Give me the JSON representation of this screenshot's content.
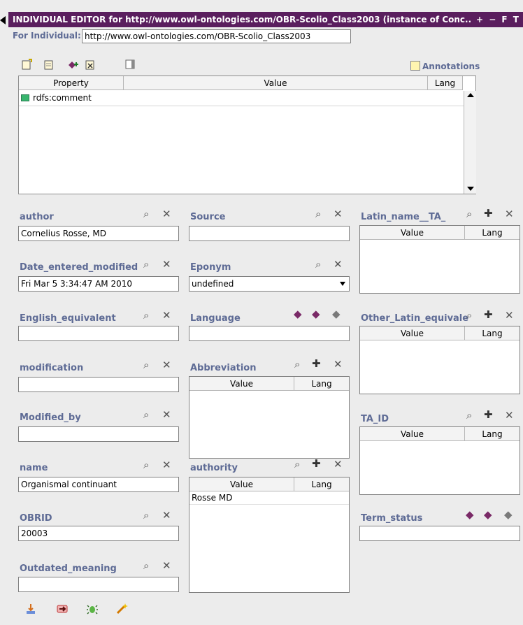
{
  "window": {
    "title": "INDIVIDUAL EDITOR for http://www.owl-ontologies.com/OBR-Scolio_Class2003   (instance of Conc...",
    "title_tools": "+ − F T"
  },
  "individual": {
    "label": "For Individual:",
    "value": "http://www.owl-ontologies.com/OBR-Scolio_Class2003"
  },
  "annotations": {
    "label": "Annotations",
    "columns": [
      "Property",
      "Value",
      "Lang"
    ],
    "rows": [
      {
        "property": "rdfs:comment",
        "value": "",
        "lang": ""
      }
    ]
  },
  "fields": {
    "author": {
      "label": "author",
      "value": "Cornelius Rosse, MD"
    },
    "date": {
      "label": "Date_entered_modified",
      "value": "Fri Mar 5 3:34:47 AM 2010"
    },
    "english": {
      "label": "English_equivalent",
      "value": ""
    },
    "modification": {
      "label": "modification",
      "value": ""
    },
    "modified_by": {
      "label": "Modified_by",
      "value": ""
    },
    "name": {
      "label": "name",
      "value": "Organismal continuant"
    },
    "obrid": {
      "label": "OBRID",
      "value": "20003"
    },
    "outdated": {
      "label": "Outdated_meaning",
      "value": ""
    },
    "source": {
      "label": "Source",
      "value": ""
    },
    "eponym": {
      "label": "Eponym",
      "value": "undefined"
    },
    "language": {
      "label": "Language",
      "value": ""
    },
    "abbreviation": {
      "label": "Abbreviation",
      "columns": [
        "Value",
        "Lang"
      ]
    },
    "authority": {
      "label": "authority",
      "columns": [
        "Value",
        "Lang"
      ],
      "rows": [
        {
          "value": "Rosse MD",
          "lang": ""
        }
      ]
    },
    "latin_name": {
      "label": "Latin_name__TA_",
      "columns": [
        "Value",
        "Lang"
      ]
    },
    "other_latin": {
      "label": "Other_Latin_equivale",
      "columns": [
        "Value",
        "Lang"
      ]
    },
    "ta_id": {
      "label": "TA_ID",
      "columns": [
        "Value",
        "Lang"
      ]
    },
    "term_status": {
      "label": "Term_status",
      "value": ""
    }
  },
  "icons": {
    "search": "search-icon",
    "remove": "remove-icon",
    "add": "add-icon"
  }
}
